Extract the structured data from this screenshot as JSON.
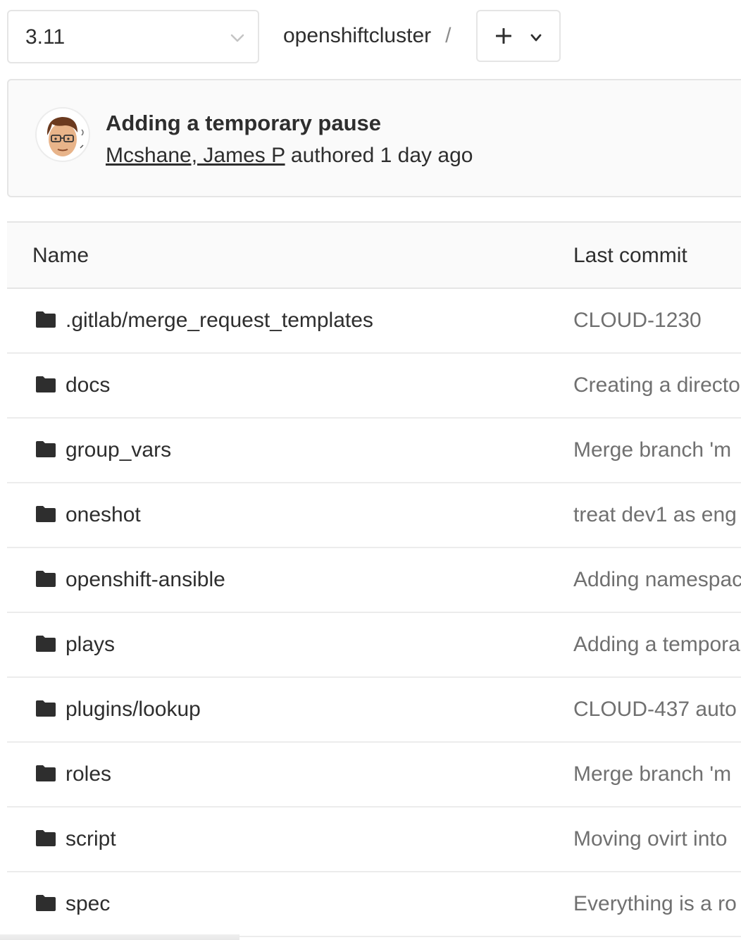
{
  "nav": {
    "branch": "3.11",
    "project": "openshiftcluster",
    "separator": "/",
    "add_icon": "plus-icon",
    "dropdown_icon": "chevron-down-icon"
  },
  "last_commit": {
    "title": "Adding a temporary pause",
    "author": "Mcshane, James P",
    "authored_text": " authored 1 day ago",
    "avatar_icon": "user-avatar"
  },
  "tree": {
    "headers": {
      "name": "Name",
      "last_commit": "Last commit"
    },
    "rows": [
      {
        "name": ".gitlab/merge_request_templates",
        "commit": "CLOUD-1230"
      },
      {
        "name": "docs",
        "commit": "Creating a directo"
      },
      {
        "name": "group_vars",
        "commit": "Merge branch 'm"
      },
      {
        "name": "oneshot",
        "commit": "treat dev1 as eng"
      },
      {
        "name": "openshift-ansible",
        "commit": "Adding namespac"
      },
      {
        "name": "plays",
        "commit": "Adding a tempora"
      },
      {
        "name": "plugins/lookup",
        "commit": "CLOUD-437 auto"
      },
      {
        "name": "roles",
        "commit": "Merge branch 'm"
      },
      {
        "name": "script",
        "commit": "Moving ovirt into"
      },
      {
        "name": "spec",
        "commit": "Everything is a ro"
      }
    ]
  },
  "colors": {
    "text": "#2e2e2e",
    "muted": "#707070",
    "border": "#e5e5e5",
    "panel_bg": "#fafafa"
  }
}
